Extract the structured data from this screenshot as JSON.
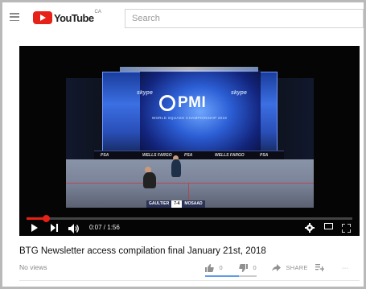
{
  "header": {
    "logo_text": "YouTube",
    "logo_region": "CA",
    "search_placeholder": "Search"
  },
  "player": {
    "sponsor_left": "skype",
    "sponsor_right": "skype",
    "brand": "PMI",
    "championship_text": "WORLD SQUASH CHAMPIONSHIP 2018",
    "board_texts": [
      "PSA",
      "WELLS FARGO",
      "PSA",
      "WELLS FARGO",
      "PSA"
    ],
    "scorebug": {
      "player1": "GAULTIER",
      "score": "7-4",
      "player2": "MOSAAD"
    },
    "current_time": "0:07",
    "duration": "1:56",
    "time_display": "0:07 / 1:56",
    "progress_fraction": 0.06
  },
  "video": {
    "title": "BTG Newsletter access compilation final January 21st, 2018",
    "views": "No views",
    "likes": "0",
    "dislikes": "0",
    "share_label": "SHARE",
    "more_label": "···",
    "like_fraction": 0.65
  },
  "colors": {
    "accent": "#e62117",
    "like_bar": "#5e9be8"
  }
}
